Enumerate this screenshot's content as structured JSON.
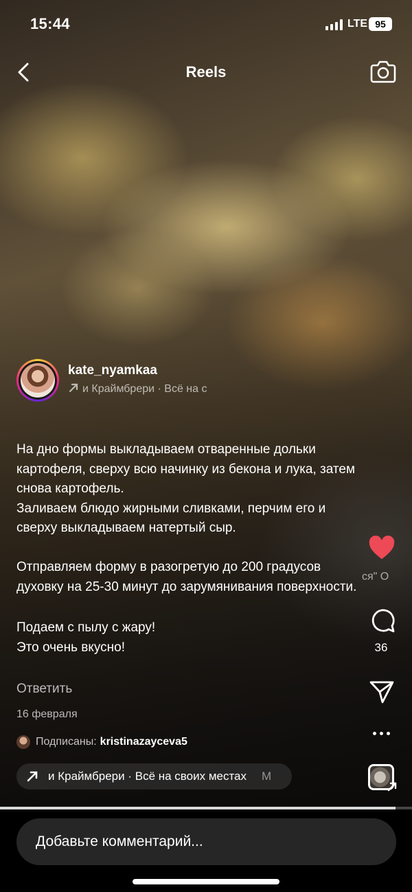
{
  "status_bar": {
    "time": "15:44",
    "network": "LTE",
    "battery": "95"
  },
  "header": {
    "title": "Reels",
    "back_icon": "chevron-left-icon",
    "camera_icon": "camera-icon"
  },
  "author": {
    "username": "kate_nyamkaa",
    "audio": "и Краймбрери · Всё на с"
  },
  "caption": {
    "paragraphs": [
      "На дно формы выкладываем отваренные дольки картофеля, сверху всю начинку из бекона и лука, затем снова картофель.",
      "Заливаем блюдо жирными сливками, перчим его и сверху выкладываем натертый сыр.",
      "",
      "Отправляем форму в разогретую до 200 градусов духовку на 25-30 минут до зарумянивания поверхности.",
      "",
      "Подаем с пылу с жару!",
      "Это очень вкусно!"
    ],
    "reply_label": "Ответить",
    "date": "16 февраля"
  },
  "followers": {
    "label": "Подписаны:",
    "name": "kristinazayceva5"
  },
  "music": {
    "text": "и Краймбрери · Всё на своих местах",
    "tail": "М"
  },
  "rail": {
    "likes_text": "ся\"   О",
    "comments_count": "36",
    "like_color": "#ed4956"
  },
  "video": {
    "progress": 0.96
  },
  "comment": {
    "placeholder": "Добавьте комментарий..."
  }
}
